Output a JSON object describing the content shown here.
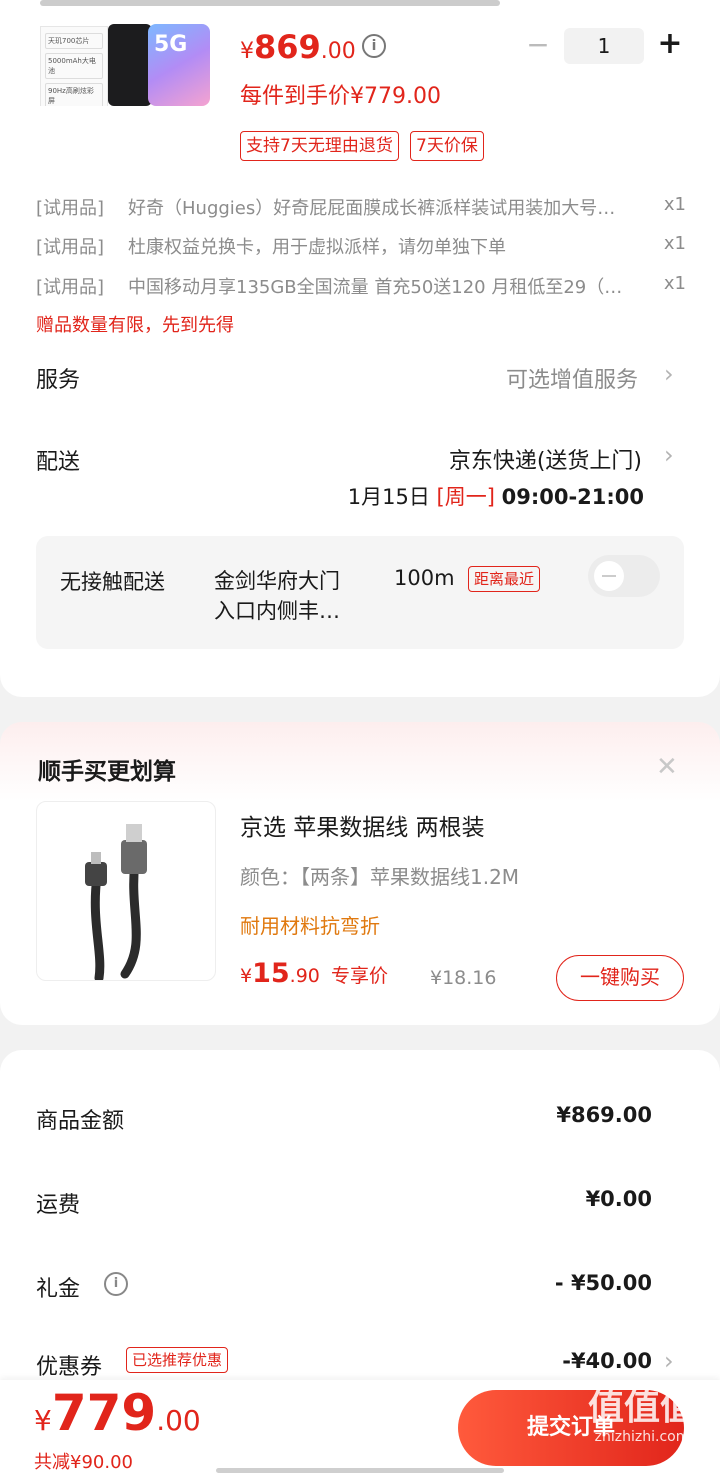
{
  "product": {
    "image_lines": [
      "天玑700芯片",
      "5000mAh大电池",
      "90Hz高刷炫彩屏"
    ],
    "image_badge": "5G",
    "price_symbol": "¥",
    "price_int": "869",
    "price_dec": ".00",
    "unit_price_label": "每件到手价¥779.00",
    "qty": "1",
    "minus": "−",
    "plus": "+",
    "tags": [
      "支持7天无理由退货",
      "7天价保"
    ]
  },
  "gifts": [
    {
      "kind": "[试用品]",
      "name": "好奇（Huggies）好奇屁屁面膜成长裤派样装试用装加大号…",
      "qty": "x1"
    },
    {
      "kind": "[试用品]",
      "name": "杜康权益兑换卡，用于虚拟派样，请勿单独下单",
      "qty": "x1"
    },
    {
      "kind": "[试用品]",
      "name": "中国移动月享135GB全国流量 首充50送120 月租低至29（…",
      "qty": "x1"
    }
  ],
  "gift_notice": "赠品数量有限，先到先得",
  "service": {
    "label": "服务",
    "value": "可选增值服务"
  },
  "delivery": {
    "label": "配送",
    "method": "京东快递(送货上门)",
    "date": "1月15日",
    "weekday": "[周一]",
    "time": "09:00-21:00"
  },
  "contactless": {
    "label": "无接触配送",
    "place_line1": "金剑华府大门",
    "place_line2": "入口内侧丰…",
    "distance": "100m",
    "badge": "距离最近"
  },
  "upsell": {
    "title": "顺手买更划算",
    "close": "✕",
    "name": "京选 苹果数据线 两根装",
    "spec": "颜色：【两条】苹果数据线1.2M",
    "feature": "耐用材料抗弯折",
    "price_symbol": "¥",
    "price_int": "15",
    "price_dec": ".90",
    "price_label": "专享价",
    "orig_price": "¥18.16",
    "buy_button": "一键购买"
  },
  "summary": {
    "rows": [
      {
        "label": "商品金额",
        "value": "¥869.00"
      },
      {
        "label": "运费",
        "value": "¥0.00"
      },
      {
        "label": "礼金",
        "value": "- ¥50.00"
      },
      {
        "label": "优惠券",
        "value": "-¥40.00"
      }
    ],
    "coupon_tag": "已选推荐优惠"
  },
  "footer": {
    "total_symbol": "¥",
    "total_int": "779",
    "total_dec": ".00",
    "saved": "共减¥90.00",
    "submit": "提交订单",
    "watermark_top": "值值值",
    "watermark_bottom": "zhizhizhi.com"
  },
  "colors": {
    "accent": "#e1251b",
    "orange": "#e0790f",
    "bg": "#f2f2f2"
  }
}
